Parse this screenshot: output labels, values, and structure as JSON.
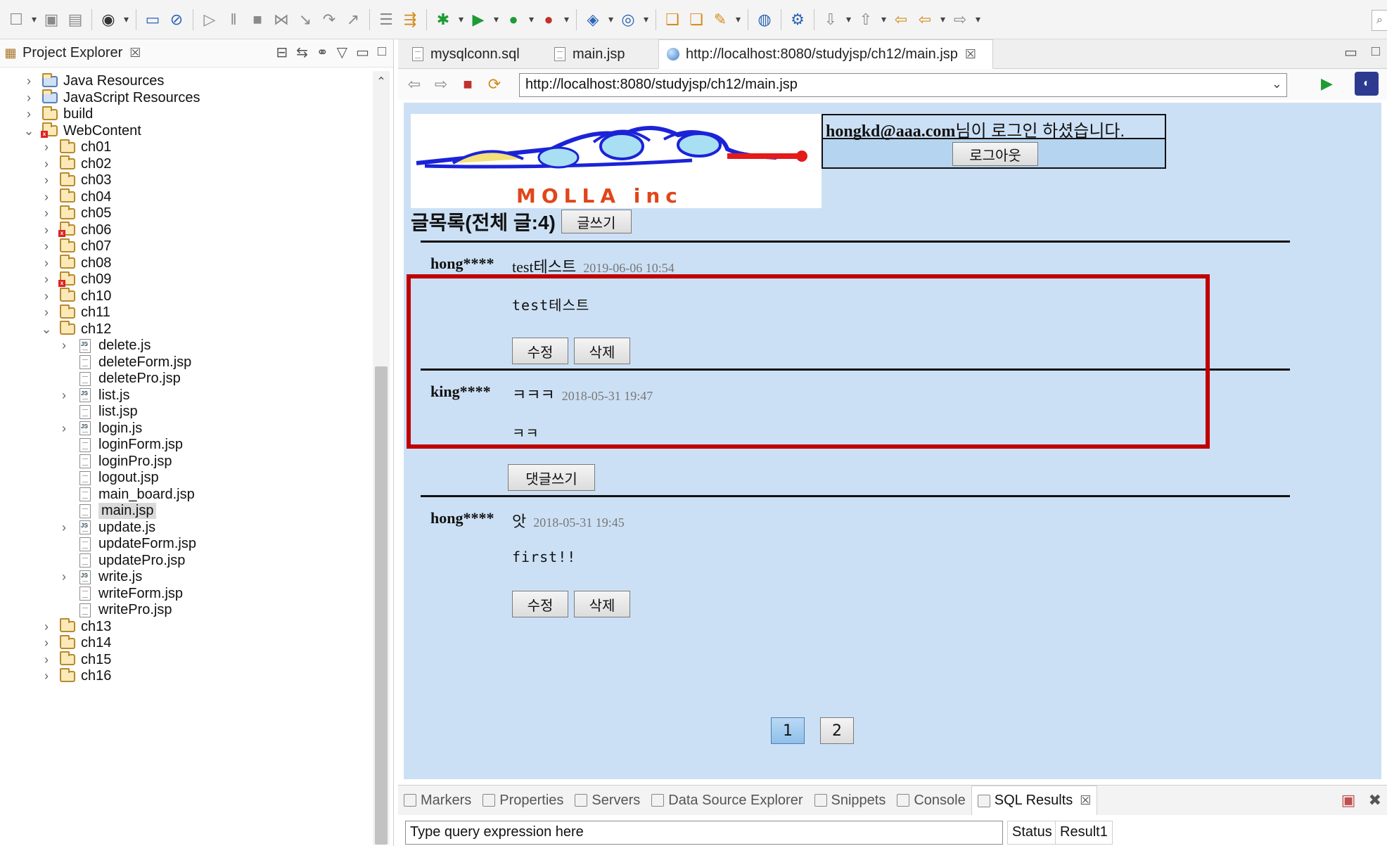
{
  "toolbar": {
    "icons": [
      "new-icon",
      "save-icon",
      "save-all-icon",
      "run-config-icon",
      "console-icon",
      "skip-breakpoints-icon",
      "resume-icon",
      "suspend-icon",
      "terminate-icon",
      "disconnect-icon",
      "step-into-icon",
      "step-over-icon",
      "step-return-icon",
      "drop-frame-icon",
      "use-step-filters-icon",
      "debug-icon",
      "run-icon",
      "run-server-icon",
      "external-tools-icon",
      "new-class-icon",
      "new-java-icon",
      "open-type-icon",
      "open-task-icon",
      "search-icon",
      "globe-icon",
      "next-annotation-icon",
      "prev-annotation-icon",
      "last-edit-icon",
      "back-icon",
      "forward-icon",
      "quick-access-icon"
    ]
  },
  "explorer": {
    "title": "Project Explorer",
    "tree": [
      {
        "label": "Java Resources",
        "indent": 0,
        "type": "lib",
        "expanded": false,
        "chev": true
      },
      {
        "label": "JavaScript Resources",
        "indent": 0,
        "type": "lib",
        "expanded": false,
        "chev": true
      },
      {
        "label": "build",
        "indent": 0,
        "type": "folder",
        "expanded": false,
        "chev": true
      },
      {
        "label": "WebContent",
        "indent": 0,
        "type": "folder",
        "expanded": true,
        "chev": true,
        "error": true
      },
      {
        "label": "ch01",
        "indent": 1,
        "type": "folder",
        "chev": true
      },
      {
        "label": "ch02",
        "indent": 1,
        "type": "folder",
        "chev": true
      },
      {
        "label": "ch03",
        "indent": 1,
        "type": "folder",
        "chev": true
      },
      {
        "label": "ch04",
        "indent": 1,
        "type": "folder",
        "chev": true
      },
      {
        "label": "ch05",
        "indent": 1,
        "type": "folder",
        "chev": true
      },
      {
        "label": "ch06",
        "indent": 1,
        "type": "folder",
        "chev": true,
        "error": true
      },
      {
        "label": "ch07",
        "indent": 1,
        "type": "folder",
        "chev": true
      },
      {
        "label": "ch08",
        "indent": 1,
        "type": "folder",
        "chev": true
      },
      {
        "label": "ch09",
        "indent": 1,
        "type": "folder",
        "chev": true,
        "error": true
      },
      {
        "label": "ch10",
        "indent": 1,
        "type": "folder",
        "chev": true
      },
      {
        "label": "ch11",
        "indent": 1,
        "type": "folder",
        "chev": true
      },
      {
        "label": "ch12",
        "indent": 1,
        "type": "folder",
        "expanded": true,
        "chev": true
      },
      {
        "label": "delete.js",
        "indent": 2,
        "type": "js",
        "chev": true
      },
      {
        "label": "deleteForm.jsp",
        "indent": 2,
        "type": "file"
      },
      {
        "label": "deletePro.jsp",
        "indent": 2,
        "type": "file"
      },
      {
        "label": "list.js",
        "indent": 2,
        "type": "js",
        "chev": true
      },
      {
        "label": "list.jsp",
        "indent": 2,
        "type": "file"
      },
      {
        "label": "login.js",
        "indent": 2,
        "type": "js",
        "chev": true
      },
      {
        "label": "loginForm.jsp",
        "indent": 2,
        "type": "file"
      },
      {
        "label": "loginPro.jsp",
        "indent": 2,
        "type": "file"
      },
      {
        "label": "logout.jsp",
        "indent": 2,
        "type": "file"
      },
      {
        "label": "main_board.jsp",
        "indent": 2,
        "type": "file"
      },
      {
        "label": "main.jsp",
        "indent": 2,
        "type": "file",
        "selected": true
      },
      {
        "label": "update.js",
        "indent": 2,
        "type": "js",
        "chev": true
      },
      {
        "label": "updateForm.jsp",
        "indent": 2,
        "type": "file"
      },
      {
        "label": "updatePro.jsp",
        "indent": 2,
        "type": "file"
      },
      {
        "label": "write.js",
        "indent": 2,
        "type": "js",
        "chev": true
      },
      {
        "label": "writeForm.jsp",
        "indent": 2,
        "type": "file"
      },
      {
        "label": "writePro.jsp",
        "indent": 2,
        "type": "file"
      },
      {
        "label": "ch13",
        "indent": 1,
        "type": "folder",
        "chev": true
      },
      {
        "label": "ch14",
        "indent": 1,
        "type": "folder",
        "chev": true
      },
      {
        "label": "ch15",
        "indent": 1,
        "type": "folder",
        "chev": true
      },
      {
        "label": "ch16",
        "indent": 1,
        "type": "folder",
        "chev": true
      }
    ]
  },
  "editor": {
    "tabs": [
      {
        "label": "mysqlconn.sql",
        "icon": "sql-file-icon"
      },
      {
        "label": "main.jsp",
        "icon": "jsp-file-icon"
      },
      {
        "label": "http://localhost:8080/studyjsp/ch12/main.jsp",
        "icon": "globe-icon",
        "active": true
      }
    ],
    "url": "http://localhost:8080/studyjsp/ch12/main.jsp"
  },
  "page": {
    "logo_text": "MOLLA inc",
    "login_email": "hongkd@aaa.com",
    "login_suffix": "님이 로그인 하셨습니다.",
    "logout_label": "로그아웃",
    "list_heading": "글목록(전체 글:4)",
    "write_label": "글쓰기",
    "posts": [
      {
        "author": "hong****",
        "title": "test테스트",
        "date": "2019-06-06 10:54",
        "body": "test테스트",
        "buttons": [
          "수정",
          "삭제"
        ]
      },
      {
        "author": "king****",
        "title": "ㅋㅋㅋ",
        "date": "2018-05-31 19:47",
        "body": "ㅋㅋ",
        "buttons": [
          "댓글쓰기"
        ]
      },
      {
        "author": "hong****",
        "title": "앗",
        "date": "2018-05-31 19:45",
        "body": "first!!",
        "buttons": [
          "수정",
          "삭제"
        ]
      }
    ],
    "pages": [
      "1",
      "2"
    ],
    "current_page": "1"
  },
  "bottom": {
    "tabs": [
      "Markers",
      "Properties",
      "Servers",
      "Data Source Explorer",
      "Snippets",
      "Console",
      "SQL Results"
    ],
    "active_tab": "SQL Results",
    "query_placeholder": "Type query expression here",
    "status_label": "Status",
    "result_label": "Result1"
  }
}
